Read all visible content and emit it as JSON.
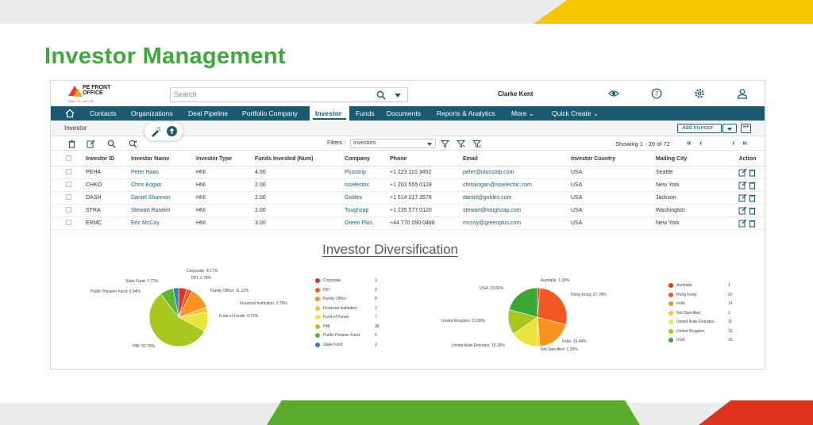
{
  "headline": "Investor Management",
  "app": {
    "logo": {
      "brand": "PE FRONT OFFICE",
      "tagline": "DEAL • PC • AC • IR"
    },
    "search": {
      "placeholder": "Search"
    },
    "user_name": "Clarke Kent",
    "nav": [
      "Contacts",
      "Organizations",
      "Deal Pipeline",
      "Portfolio Company",
      "Investor",
      "Funds",
      "Documents",
      "Reports & Analytics",
      "More",
      "Quick Create"
    ],
    "active_nav": "Investor",
    "breadcrumb": "Investor",
    "add_investor_label": "Add Investor",
    "more_label": "•••",
    "filters_label": "Filters :",
    "filter_value": "Investors",
    "showing": "Showing 1 - 20 of 72",
    "pager": {
      "first": "«",
      "prev": "‹",
      "next": "›",
      "last": "»"
    },
    "table": {
      "columns": [
        "Investor ID",
        "Investor Name",
        "Investor Type",
        "Funds Invested (Num)",
        "Company",
        "Phone",
        "Email",
        "Investor Country",
        "Mailing City",
        "Action"
      ],
      "rows": [
        [
          "PEHA",
          "Peter Haas",
          "HNI",
          "4.00",
          "Plusstrip",
          "+1 223 110 3452",
          "peter@plusstrip.com",
          "USA",
          "Seattle"
        ],
        [
          "CHKO",
          "Chris Kogan",
          "HNI",
          "2.00",
          "Isselectric",
          "+1 202 555 0128",
          "chriskogan@isselectric.com",
          "USA",
          "New York"
        ],
        [
          "DASH",
          "Daniel Shannon",
          "HNI",
          "2.00",
          "Goldex",
          "+1 514 217 3578",
          "daniel@goldex.com",
          "USA",
          "Jackson"
        ],
        [
          "STRA",
          "Stewart Rasekh",
          "HNI",
          "2.00",
          "Toughzap",
          "+1 235 577 0120",
          "stewart@toughzap.com",
          "USA",
          "Washington"
        ],
        [
          "ERMC",
          "Eric McCoy",
          "HNI",
          "3.00",
          "Green Plus",
          "+44 770 090 0488",
          "mccoy@greenplus.com",
          "USA",
          "New York"
        ]
      ]
    }
  },
  "chart_data": [
    {
      "type": "pie",
      "title": "Investor Diversification",
      "categories": [
        "Corporate",
        "DFI",
        "Family Office",
        "Financial Institution",
        "Fund of Funds",
        "HNI",
        "Public Pension Fund",
        "State Fund"
      ],
      "values": [
        3,
        2,
        8,
        2,
        7,
        38,
        5,
        2
      ],
      "colors": [
        "#e8311c",
        "#f15a24",
        "#f7931e",
        "#f9c23c",
        "#ede43b",
        "#a7c91f",
        "#5bb82d",
        "#2e7fc2"
      ],
      "slice_labels": [
        "Corporate: 4.17%",
        "DFI: 2.78%",
        "Family Office: 11.11%",
        "Financial Institution: 2.78%",
        "Fund of Funds: 9.72%",
        "HNI: 52.78%",
        "Public Pension Fund: 6.94%",
        "State Fund: 2.72%"
      ]
    },
    {
      "type": "pie",
      "categories": [
        "Australia",
        "Hong Kong",
        "India",
        "Not Specified",
        "United Arab Emirates",
        "United Kingdom",
        "USA"
      ],
      "values": [
        1,
        20,
        14,
        1,
        11,
        10,
        15
      ],
      "colors": [
        "#e8311c",
        "#f15a24",
        "#f7931e",
        "#f9c23c",
        "#ede43b",
        "#a7c91f",
        "#3aa832"
      ],
      "slice_labels": [
        "Australia: 1.39%",
        "Hong Kong: 27.78%",
        "India: 19.44%",
        "Not Specified: 1.39%",
        "United Arab Emirates: 15.28%",
        "United Kingdom: 13.89%",
        "USA: 20.83%"
      ]
    }
  ]
}
